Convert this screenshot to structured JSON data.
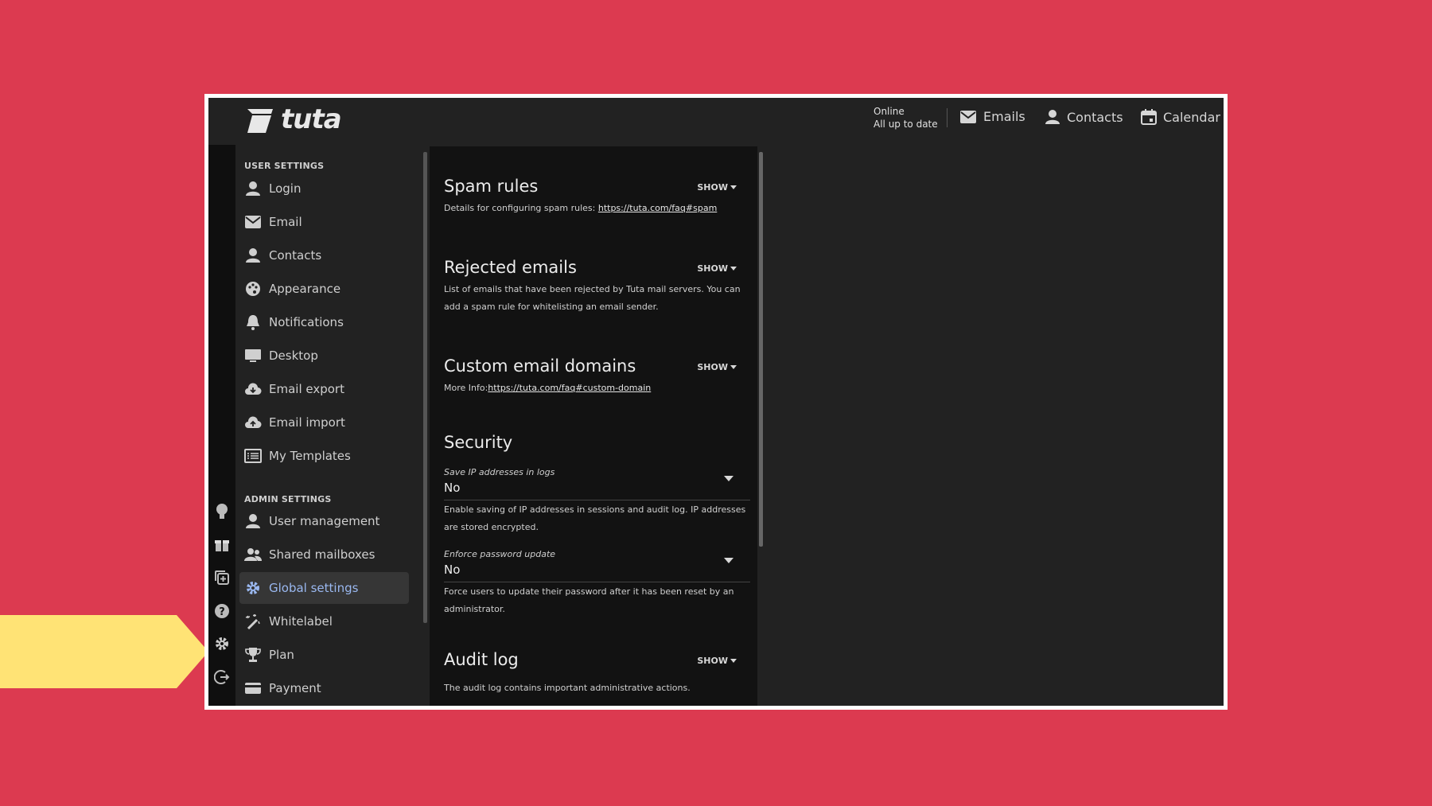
{
  "header": {
    "logo_text": "tuta",
    "status_line1": "Online",
    "status_line2": "All up to date",
    "nav": [
      {
        "label": "Emails",
        "icon": "mail-icon"
      },
      {
        "label": "Contacts",
        "icon": "person-icon"
      },
      {
        "label": "Calendar",
        "icon": "calendar-icon"
      }
    ]
  },
  "sidebar": {
    "user_section": "USER SETTINGS",
    "user_items": [
      {
        "label": "Login",
        "icon": "person-icon"
      },
      {
        "label": "Email",
        "icon": "mail-icon"
      },
      {
        "label": "Contacts",
        "icon": "person-icon"
      },
      {
        "label": "Appearance",
        "icon": "palette-icon"
      },
      {
        "label": "Notifications",
        "icon": "bell-icon"
      },
      {
        "label": "Desktop",
        "icon": "monitor-icon"
      },
      {
        "label": "Email export",
        "icon": "cloud-download-icon"
      },
      {
        "label": "Email import",
        "icon": "cloud-upload-icon"
      },
      {
        "label": "My Templates",
        "icon": "list-icon"
      }
    ],
    "admin_section": "ADMIN SETTINGS",
    "admin_items": [
      {
        "label": "User management",
        "icon": "person-icon"
      },
      {
        "label": "Shared mailboxes",
        "icon": "people-icon"
      },
      {
        "label": "Global settings",
        "icon": "gear-icon",
        "active": true
      },
      {
        "label": "Whitelabel",
        "icon": "wand-icon"
      },
      {
        "label": "Plan",
        "icon": "trophy-icon"
      },
      {
        "label": "Payment",
        "icon": "card-icon"
      }
    ]
  },
  "main": {
    "spam_rules": {
      "title": "Spam rules",
      "show": "SHOW",
      "desc": "Details for configuring spam rules: ",
      "link": "https://tuta.com/faq#spam"
    },
    "rejected": {
      "title": "Rejected emails",
      "show": "SHOW",
      "desc": "List of emails that have been rejected by Tuta mail servers. You can add a spam rule for whitelisting an email sender."
    },
    "domains": {
      "title": "Custom email domains",
      "show": "SHOW",
      "desc": "More Info:",
      "link": "https://tuta.com/faq#custom-domain"
    },
    "security": {
      "title": "Security",
      "save_ip_label": "Save IP addresses in logs",
      "save_ip_value": "No",
      "save_ip_desc": "Enable saving of IP addresses in sessions and audit log. IP addresses are stored encrypted.",
      "pw_label": "Enforce password update",
      "pw_value": "No",
      "pw_desc": "Force users to update their password after it has been reset by an administrator."
    },
    "audit": {
      "title": "Audit log",
      "show": "SHOW",
      "desc": "The audit log contains important administrative actions."
    }
  },
  "colors": {
    "background": "#dc3a50",
    "accent_active": "#9ab8f0",
    "pointer": "#ffe375"
  }
}
